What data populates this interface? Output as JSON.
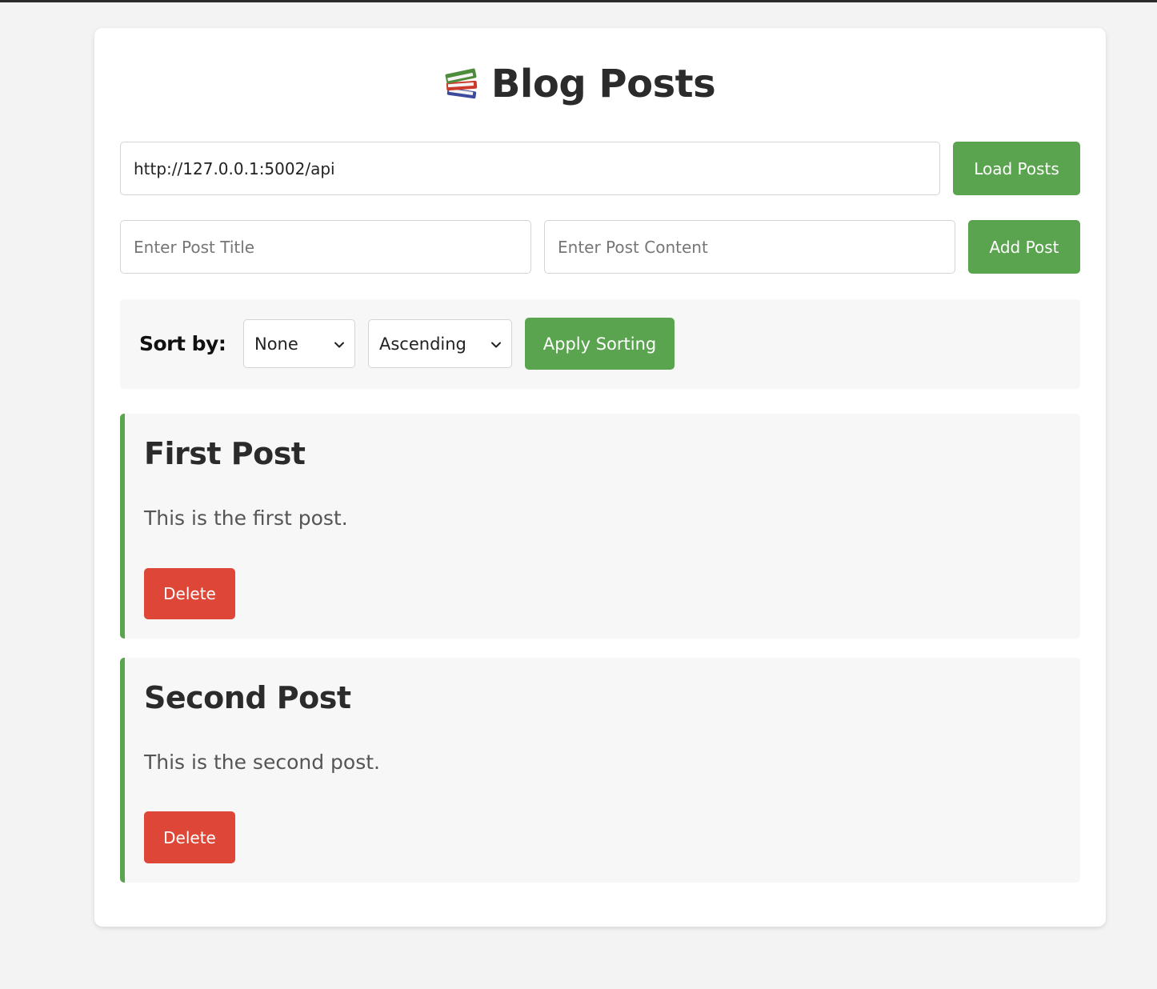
{
  "header": {
    "title": "Blog Posts",
    "icon": "books-icon"
  },
  "api": {
    "url_value": "http://127.0.0.1:5002/api",
    "load_label": "Load Posts"
  },
  "new_post": {
    "title_placeholder": "Enter Post Title",
    "content_placeholder": "Enter Post Content",
    "add_label": "Add Post"
  },
  "sorting": {
    "label": "Sort by:",
    "field_selected": "None",
    "direction_selected": "Ascending",
    "apply_label": "Apply Sorting"
  },
  "posts": [
    {
      "title": "First Post",
      "content": "This is the first post.",
      "delete_label": "Delete"
    },
    {
      "title": "Second Post",
      "content": "This is the second post.",
      "delete_label": "Delete"
    }
  ],
  "colors": {
    "accent_green": "#5ba44f",
    "delete_red": "#de4637",
    "page_bg": "#f3f3f3",
    "card_bg": "#ffffff",
    "panel_bg": "#f7f7f7"
  }
}
